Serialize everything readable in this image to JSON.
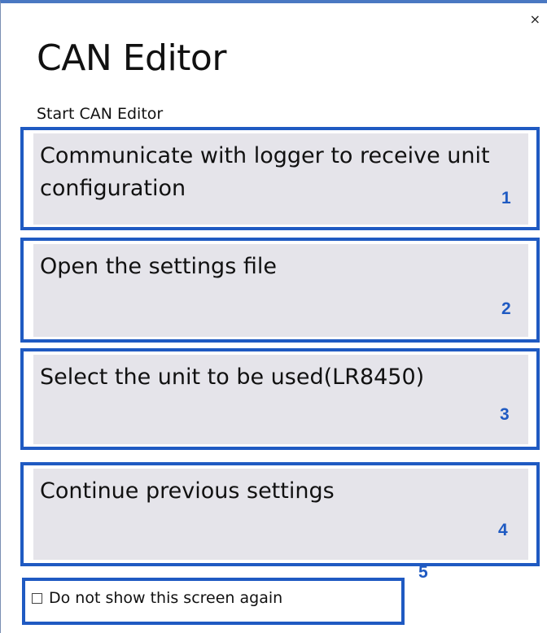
{
  "window": {
    "title": "CAN Editor",
    "subtitle": "Start CAN Editor",
    "close_label": "×"
  },
  "options": [
    {
      "label": "Communicate with logger to receive unit configuration",
      "number": "1"
    },
    {
      "label": "Open the settings file",
      "number": "2"
    },
    {
      "label": "Select the unit to be used(LR8450)",
      "number": "3"
    },
    {
      "label": "Continue previous settings",
      "number": "4"
    }
  ],
  "checkbox": {
    "label": "Do not show this screen again",
    "checked": false,
    "number": "5"
  },
  "colors": {
    "highlight": "#1f5ac2",
    "option_bg": "#e5e4ea"
  }
}
